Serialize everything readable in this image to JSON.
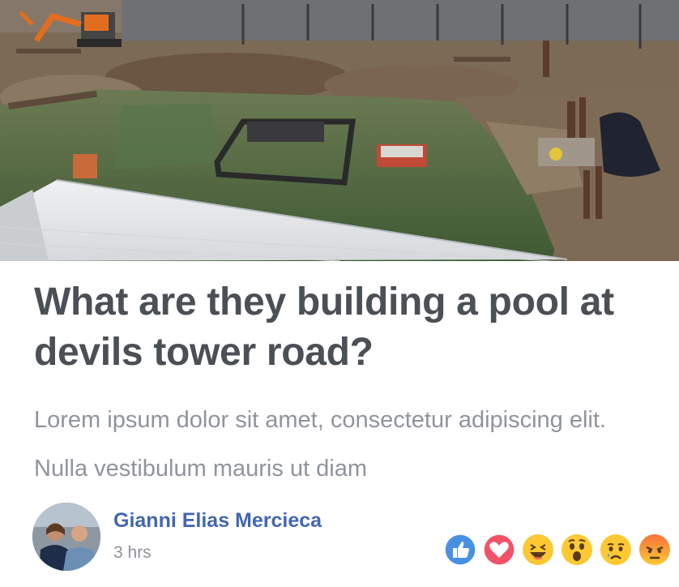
{
  "post": {
    "title": "What are they building a pool at devils tower road?",
    "excerpt": "Lorem ipsum dolor sit amet, consectetur adipiscing elit. Nulla vestibulum mauris ut diam",
    "image": "construction-site-flooded-photo"
  },
  "author": {
    "name": "Gianni Elias Mercieca",
    "time": "3 hrs",
    "avatar": "author-avatar-photo"
  },
  "reactions": [
    {
      "name": "like",
      "icon": "thumbs-up-icon",
      "color": "#4a90e2"
    },
    {
      "name": "love",
      "icon": "heart-icon",
      "color": "#f25268"
    },
    {
      "name": "haha",
      "icon": "laughing-face-icon",
      "color": "#fcc934"
    },
    {
      "name": "wow",
      "icon": "surprised-face-icon",
      "color": "#fcc934"
    },
    {
      "name": "sad",
      "icon": "crying-face-icon",
      "color": "#fcc934"
    },
    {
      "name": "angry",
      "icon": "angry-face-icon",
      "color": "#f4733c"
    }
  ],
  "colors": {
    "title": "#4b4f56",
    "excerpt": "#90949c",
    "author_name": "#4267b2"
  }
}
